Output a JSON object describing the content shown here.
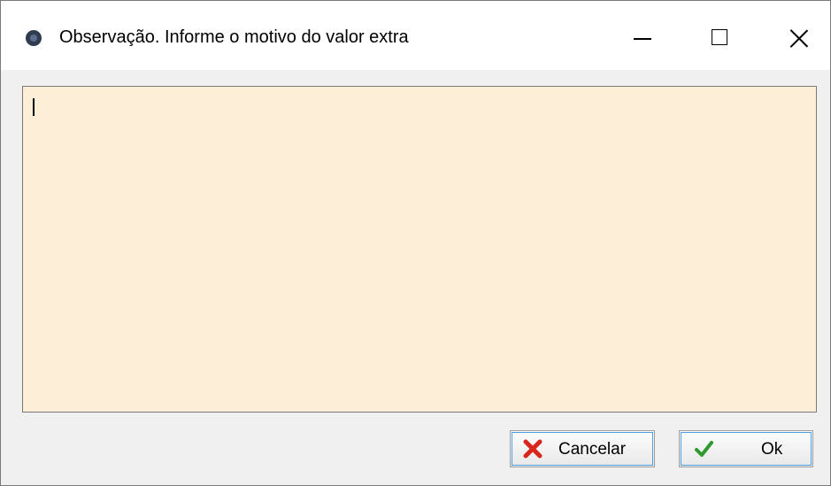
{
  "window": {
    "title": "Observação. Informe o motivo do valor extra",
    "app_icon": "app-logo-icon",
    "controls": {
      "minimize_icon": "minimize-icon",
      "maximize_icon": "maximize-icon",
      "close_icon": "close-icon"
    }
  },
  "memo": {
    "value": "",
    "background_color": "#fdeed8"
  },
  "buttons": {
    "cancel_label": "Cancelar",
    "cancel_icon": "red-x-icon",
    "cancel_icon_color": "#d9261c",
    "ok_label": "Ok",
    "ok_icon": "green-check-icon",
    "ok_icon_color": "#2e9a2e"
  }
}
